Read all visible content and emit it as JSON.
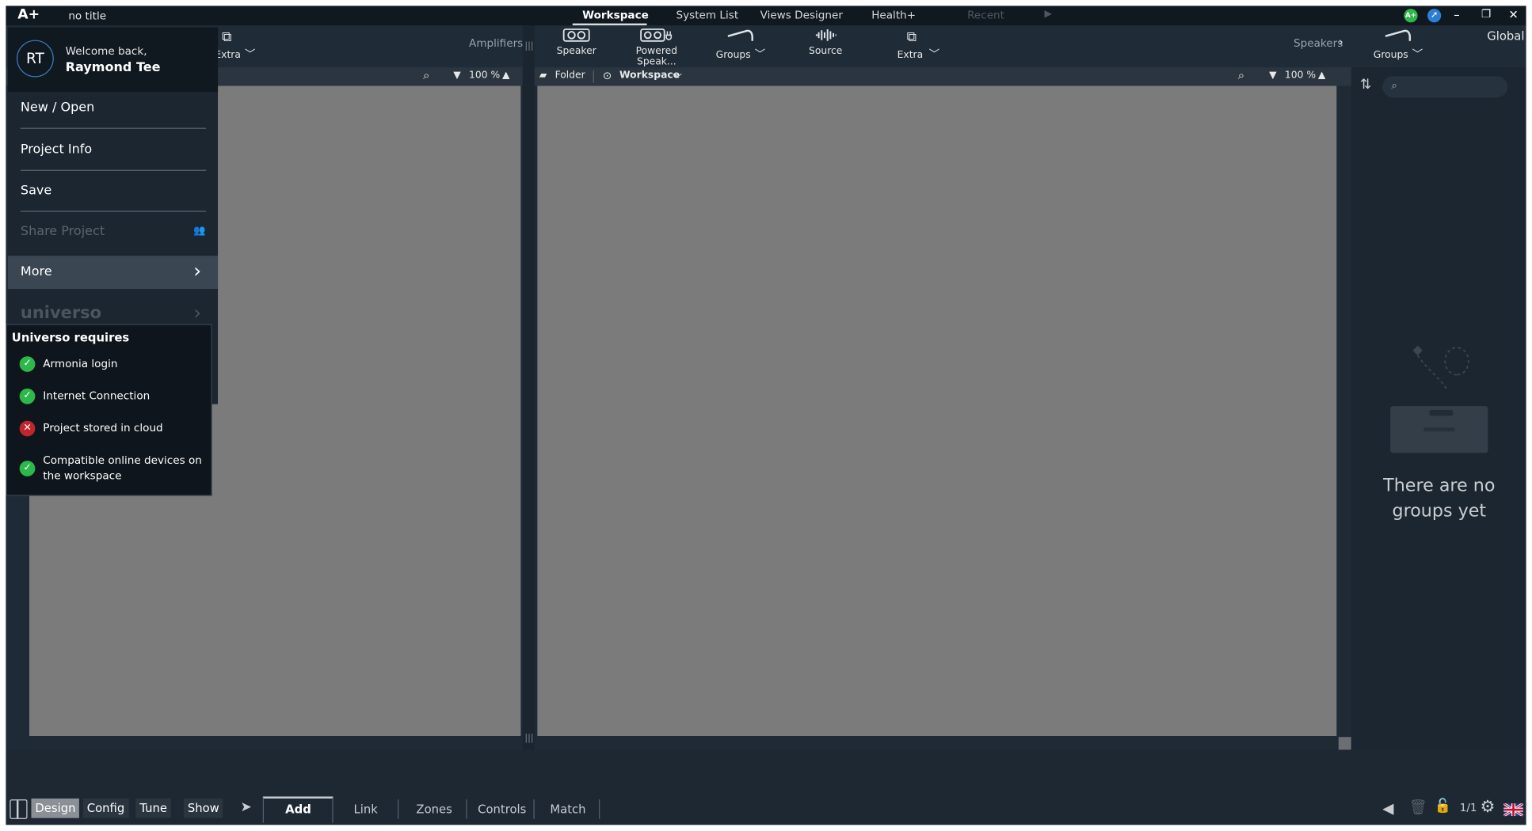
{
  "titlebar": {
    "logo": "A+",
    "doc_title": "no title",
    "tabs": [
      {
        "label": "Workspace",
        "active": true
      },
      {
        "label": "System List",
        "active": false
      },
      {
        "label": "Views Designer",
        "active": false
      },
      {
        "label": "Health+",
        "active": false
      },
      {
        "label": "Recent",
        "active": false
      }
    ],
    "window_controls": [
      "minimize",
      "restore",
      "close"
    ]
  },
  "toolbar": {
    "left_tool": "Extra",
    "left_section_label": "Amplifiers",
    "tools": [
      {
        "label": "Speaker",
        "icon": "speaker-icon"
      },
      {
        "label": "Powered Speak...",
        "icon": "powered-speaker-icon"
      },
      {
        "label": "Groups",
        "icon": "groups-icon"
      },
      {
        "label": "Source",
        "icon": "source-icon"
      },
      {
        "label": "Extra",
        "icon": "extra-icon"
      }
    ],
    "right_section_label": "Speakers",
    "right_tool": "Groups",
    "global_label": "Global"
  },
  "left_strip": {
    "zoom": "100 %"
  },
  "main_strip": {
    "folder_label": "Folder",
    "workspace_label": "Workspace",
    "zoom": "100 %"
  },
  "sidebar": {
    "search_placeholder": "",
    "empty_line1": "There are no",
    "empty_line2": "groups yet"
  },
  "menu": {
    "avatar_initials": "RT",
    "welcome": "Welcome back,",
    "user_name": "Raymond Tee",
    "items": [
      {
        "label": "New / Open"
      },
      {
        "label": "Project Info"
      },
      {
        "label": "Save"
      },
      {
        "label": "Share Project"
      }
    ],
    "more_label": "More",
    "universo_label": "universo"
  },
  "universo_popup": {
    "title": "Universo requires",
    "requirements": [
      {
        "label": "Armonia login",
        "status": "ok"
      },
      {
        "label": "Internet Connection",
        "status": "ok"
      },
      {
        "label": "Project stored in cloud",
        "status": "fail"
      },
      {
        "label": "Compatible online devices on",
        "label2": "the workspace",
        "status": "ok"
      }
    ]
  },
  "bottombar": {
    "modes": [
      {
        "label": "Design",
        "active": true
      },
      {
        "label": "Config",
        "active": false
      },
      {
        "label": "Tune",
        "active": false
      },
      {
        "label": "Show",
        "active": false
      }
    ],
    "actions": [
      {
        "label": "Add",
        "active": true
      },
      {
        "label": "Link",
        "active": false
      },
      {
        "label": "Zones",
        "active": false
      },
      {
        "label": "Controls",
        "active": false
      },
      {
        "label": "Match",
        "active": false
      }
    ],
    "page_counter": "1/1"
  },
  "colors": {
    "app_bg": "#1e2a36",
    "canvas": "#7b7b7b",
    "ok": "#2db84c",
    "fail": "#c0262c",
    "accent": "#3c7abf"
  }
}
